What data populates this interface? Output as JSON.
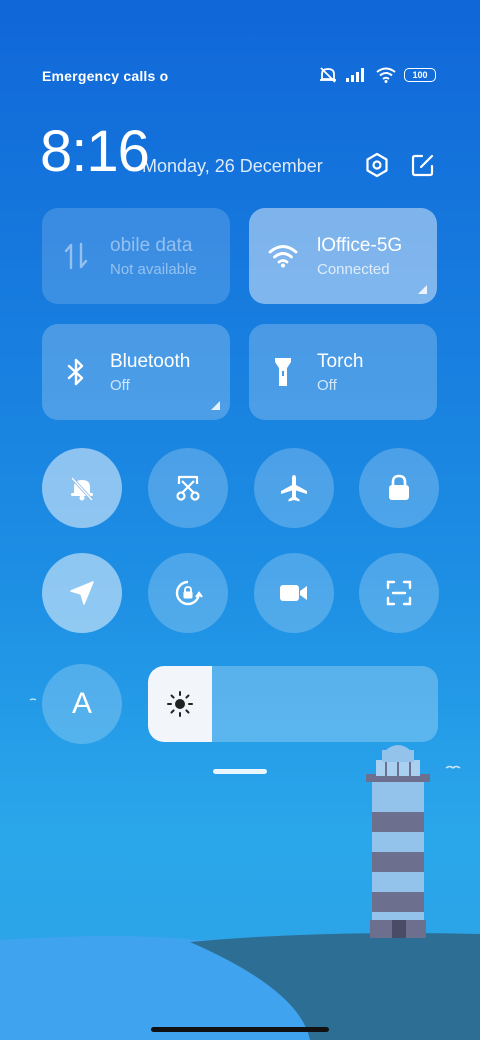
{
  "status_bar": {
    "carrier_text": "Emergency calls o",
    "battery": "100",
    "icons": [
      "mute-icon",
      "signal-icon",
      "wifi-icon",
      "battery-icon"
    ]
  },
  "header": {
    "time": "8:16",
    "date": "Monday, 26 December",
    "settings_icon": "hexagon-settings-icon",
    "edit_icon": "edit-icon"
  },
  "tiles": {
    "mobile_data": {
      "name": "obile data",
      "status": "Not available",
      "icon": "mobile-data-icon"
    },
    "wifi": {
      "name": "lOffice-5G",
      "status": "Connected",
      "icon": "wifi-icon"
    },
    "bluetooth": {
      "name": "Bluetooth",
      "status": "Off",
      "icon": "bluetooth-icon"
    },
    "torch": {
      "name": "Torch",
      "status": "Off",
      "icon": "torch-icon"
    }
  },
  "toggles": [
    {
      "name": "silent",
      "icon": "bell-off-icon",
      "active": true
    },
    {
      "name": "screenshot",
      "icon": "scissors-icon",
      "active": false
    },
    {
      "name": "airplane",
      "icon": "airplane-icon",
      "active": false
    },
    {
      "name": "lock",
      "icon": "lock-icon",
      "active": false
    },
    {
      "name": "location",
      "icon": "location-arrow-icon",
      "active": true
    },
    {
      "name": "rotation-lock",
      "icon": "rotation-lock-icon",
      "active": false
    },
    {
      "name": "screen-record",
      "icon": "video-camera-icon",
      "active": false
    },
    {
      "name": "scanner",
      "icon": "scan-icon",
      "active": false
    }
  ],
  "auto_brightness": {
    "label": "A"
  },
  "brightness": {
    "level": 0.22,
    "icon": "sun-icon"
  },
  "colors": {
    "accent": "#ffffff",
    "background_top": "#1067d8",
    "background_bottom": "#2aa6ea"
  }
}
